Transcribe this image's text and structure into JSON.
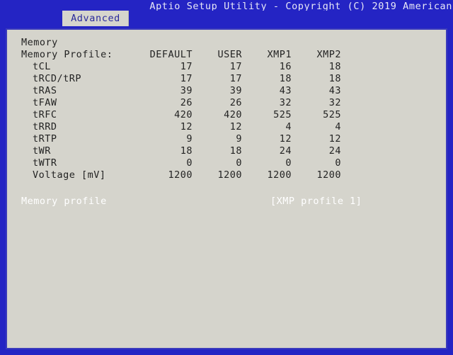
{
  "titlebar": {
    "text": "Aptio Setup Utility - Copyright (C) 2019 American"
  },
  "tabs": [
    {
      "label": "Advanced"
    }
  ],
  "panel": {
    "section_heading": "Memory",
    "table": {
      "row_label_header": "Memory Profile:",
      "columns": [
        "DEFAULT",
        "USER",
        "XMP1",
        "XMP2"
      ],
      "rows": [
        {
          "label": "tCL",
          "values": [
            "17",
            "17",
            "16",
            "18"
          ]
        },
        {
          "label": "tRCD/tRP",
          "values": [
            "17",
            "17",
            "18",
            "18"
          ]
        },
        {
          "label": "tRAS",
          "values": [
            "39",
            "39",
            "43",
            "43"
          ]
        },
        {
          "label": "tFAW",
          "values": [
            "26",
            "26",
            "32",
            "32"
          ]
        },
        {
          "label": "tRFC",
          "values": [
            "420",
            "420",
            "525",
            "525"
          ]
        },
        {
          "label": "tRRD",
          "values": [
            "12",
            "12",
            "4",
            "4"
          ]
        },
        {
          "label": "tRTP",
          "values": [
            "9",
            "9",
            "12",
            "12"
          ]
        },
        {
          "label": "tWR",
          "values": [
            "18",
            "18",
            "24",
            "24"
          ]
        },
        {
          "label": "tWTR",
          "values": [
            "0",
            "0",
            "0",
            "0"
          ]
        },
        {
          "label": "Voltage [mV]",
          "values": [
            "1200",
            "1200",
            "1200",
            "1200"
          ]
        }
      ]
    },
    "selected_option": {
      "label": "Memory profile",
      "value": "[XMP profile 1]"
    }
  },
  "colors": {
    "background_blue": "#2424c4",
    "panel_gray": "#d5d4cc",
    "panel_border": "#3b3bbb",
    "tab_text": "#2a2a9c",
    "body_text": "#232323",
    "selected_text": "#ffffff"
  }
}
